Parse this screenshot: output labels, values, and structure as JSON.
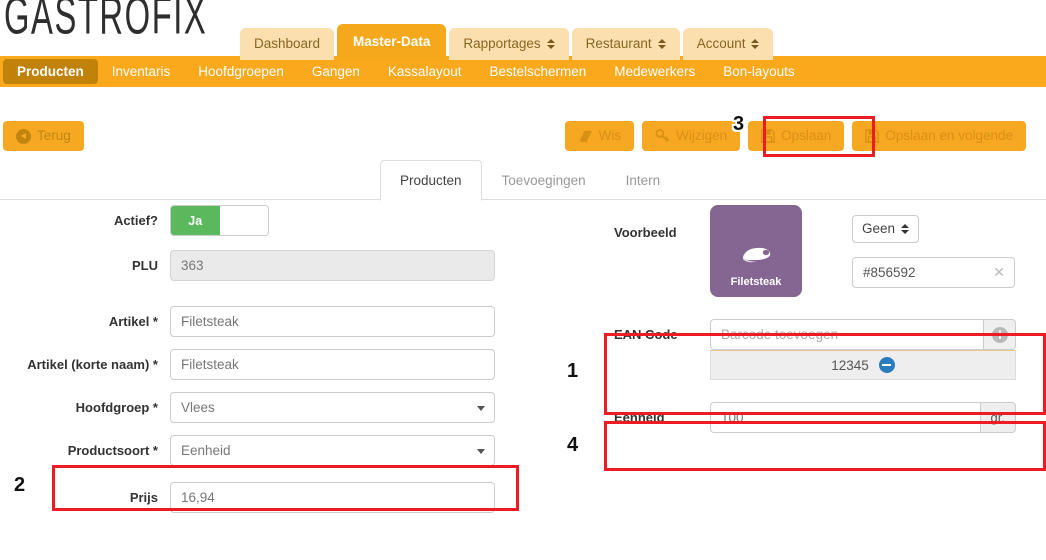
{
  "brand": {
    "logo": "GASTROFIX",
    "accent": "#fba91c",
    "accent_dark": "#c08209",
    "active_tab_bg": "#f6a81c",
    "inactive_tab_bg": "#fbdfaf",
    "annotation_color": "#ed1c24"
  },
  "mainnav": [
    {
      "label": "Dashboard",
      "active": false,
      "has_caret": false
    },
    {
      "label": "Master-Data",
      "active": true,
      "has_caret": false
    },
    {
      "label": "Rapportages",
      "active": false,
      "has_caret": true
    },
    {
      "label": "Restaurant",
      "active": false,
      "has_caret": true
    },
    {
      "label": "Account",
      "active": false,
      "has_caret": true
    }
  ],
  "subnav": [
    {
      "label": "Producten",
      "active": true
    },
    {
      "label": "Inventaris",
      "active": false
    },
    {
      "label": "Hoofdgroepen",
      "active": false
    },
    {
      "label": "Gangen",
      "active": false
    },
    {
      "label": "Kassalayout",
      "active": false
    },
    {
      "label": "Bestelschermen",
      "active": false
    },
    {
      "label": "Medewerkers",
      "active": false
    },
    {
      "label": "Bon-layouts",
      "active": false
    }
  ],
  "toolbar": {
    "back_label": "Terug",
    "buttons": [
      {
        "label": "Wis",
        "icon": "eraser-icon"
      },
      {
        "label": "Wijzigen",
        "icon": "key-icon"
      },
      {
        "label": "Opslaan",
        "icon": "save-icon"
      },
      {
        "label": "Opslaan en volgende",
        "icon": "save-icon"
      }
    ]
  },
  "tabs": [
    {
      "label": "Producten",
      "active": true
    },
    {
      "label": "Toevoegingen",
      "active": false
    },
    {
      "label": "Intern",
      "active": false
    }
  ],
  "form_left": {
    "actief": {
      "label": "Actief?",
      "value": "Ja"
    },
    "plu": {
      "label": "PLU",
      "value": "363"
    },
    "artikel": {
      "label": "Artikel *",
      "value": "Filetsteak"
    },
    "artikel_kort": {
      "label": "Artikel (korte naam) *",
      "value": "Filetsteak"
    },
    "hoofdgroep": {
      "label": "Hoofdgroep *",
      "value": "Vlees"
    },
    "productsoort": {
      "label": "Productsoort *",
      "value": "Eenheid"
    },
    "prijs": {
      "label": "Prijs",
      "value": "16,94"
    }
  },
  "form_right": {
    "voorbeeld": {
      "label": "Voorbeeld",
      "tile_label": "Filetsteak",
      "tile_color": "#856592",
      "icon": "steak-icon"
    },
    "layout_select": {
      "value": "Geen"
    },
    "color_field": {
      "value": "#856592",
      "clear_icon": "close-icon"
    },
    "ean": {
      "label": "EAN Code",
      "placeholder": "Barcode toevoegen",
      "value": "",
      "add_icon": "plus-circle-icon",
      "items": [
        {
          "code": "12345",
          "remove_icon": "minus-circle-icon"
        }
      ]
    },
    "eenheid": {
      "label": "Eenheid",
      "value": "100",
      "unit": "gr."
    }
  },
  "annotations": [
    {
      "id": "1",
      "target": "ean-code"
    },
    {
      "id": "2",
      "target": "productsoort"
    },
    {
      "id": "3",
      "target": "opslaan"
    },
    {
      "id": "4",
      "target": "eenheid"
    }
  ]
}
